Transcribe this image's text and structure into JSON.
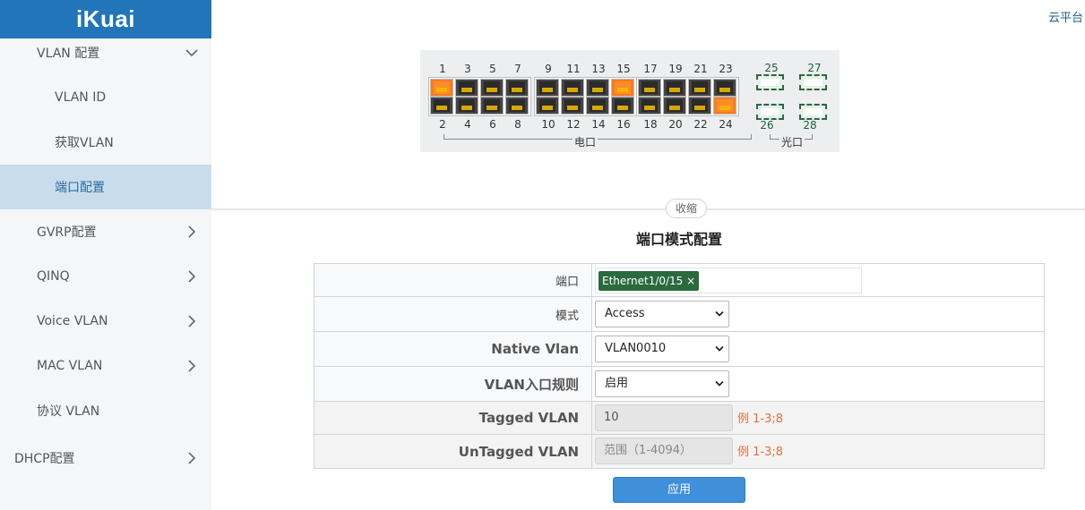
{
  "brand": {
    "logo_text": "iKuai",
    "logo_bg": "#2275b9"
  },
  "topbar": {
    "cloud_link": "云平台"
  },
  "sidebar": {
    "items": [
      {
        "label": "VLAN 配置",
        "expanded": true
      },
      {
        "label": "VLAN ID"
      },
      {
        "label": "获取VLAN"
      },
      {
        "label": "端口配置",
        "active": true
      },
      {
        "label": "GVRP配置"
      },
      {
        "label": "QINQ"
      },
      {
        "label": "Voice VLAN"
      },
      {
        "label": "MAC VLAN"
      },
      {
        "label": "协议 VLAN"
      },
      {
        "label": "DHCP配置"
      }
    ]
  },
  "switch_panel": {
    "top_numbers": [
      "1",
      "3",
      "5",
      "7",
      "9",
      "11",
      "13",
      "15",
      "17",
      "19",
      "21",
      "23"
    ],
    "bottom_numbers": [
      "2",
      "4",
      "6",
      "8",
      "10",
      "12",
      "14",
      "16",
      "18",
      "20",
      "22",
      "24"
    ],
    "fiber_top": [
      "25",
      "27"
    ],
    "fiber_bottom": [
      "26",
      "28"
    ],
    "copper_label": "电口",
    "fiber_label": "光口",
    "active_ports": [
      1,
      15,
      24
    ],
    "active_color": "#ff7a1a",
    "port_pin_color": "#d8a800"
  },
  "collapse_label": "收缩",
  "section_title": "端口模式配置",
  "form": {
    "port_label": "端口",
    "port_tag": "Ethernet1/0/15 ×",
    "mode_label": "模式",
    "mode_value": "Access",
    "native_vlan_label": "Native Vlan",
    "native_vlan_value": "VLAN0010",
    "ingress_label": "VLAN入口规则",
    "ingress_value": "启用",
    "tagged_label": "Tagged VLAN",
    "tagged_value": "10",
    "tagged_hint": "例 1-3;8",
    "untagged_label": "UnTagged VLAN",
    "untagged_placeholder": "范围（1-4094）",
    "untagged_hint": "例 1-3;8",
    "hint_color": "#e2703a"
  },
  "apply_button": "应用"
}
